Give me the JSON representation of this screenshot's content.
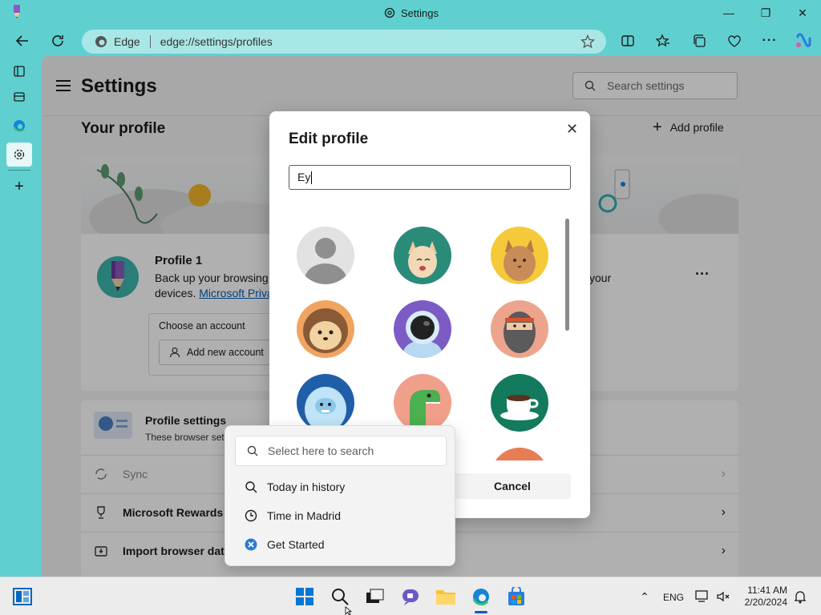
{
  "window": {
    "title": "Settings"
  },
  "address": {
    "site": "Edge",
    "url": "edge://settings/profiles"
  },
  "settings": {
    "title": "Settings",
    "search_placeholder": "Search settings"
  },
  "profile_section": {
    "heading": "Your profile",
    "add_profile": "Add profile",
    "profile_name": "Profile 1",
    "desc_line1": "Back up your browsing",
    "desc_line2": "devices.",
    "privacy_link": "Microsoft Priva",
    "right_text": "your",
    "choose_account": "Choose an account",
    "add_account": "Add new account"
  },
  "rows": {
    "profile_settings_title": "Profile settings",
    "profile_settings_desc": "These browser sett",
    "sync": "Sync",
    "rewards": "Microsoft Rewards",
    "import": "Import browser data"
  },
  "modal": {
    "title": "Edit profile",
    "name_value": "Ey",
    "cancel": "Cancel"
  },
  "flyout": {
    "search_placeholder": "Select here to search",
    "items": [
      "Today in history",
      "Time in Madrid",
      "Get Started"
    ]
  },
  "taskbar": {
    "lang": "ENG",
    "time": "11:41 AM",
    "date": "2/20/2024"
  },
  "colors": {
    "accent": "#005fb8",
    "frame": "#5fd0cf"
  }
}
